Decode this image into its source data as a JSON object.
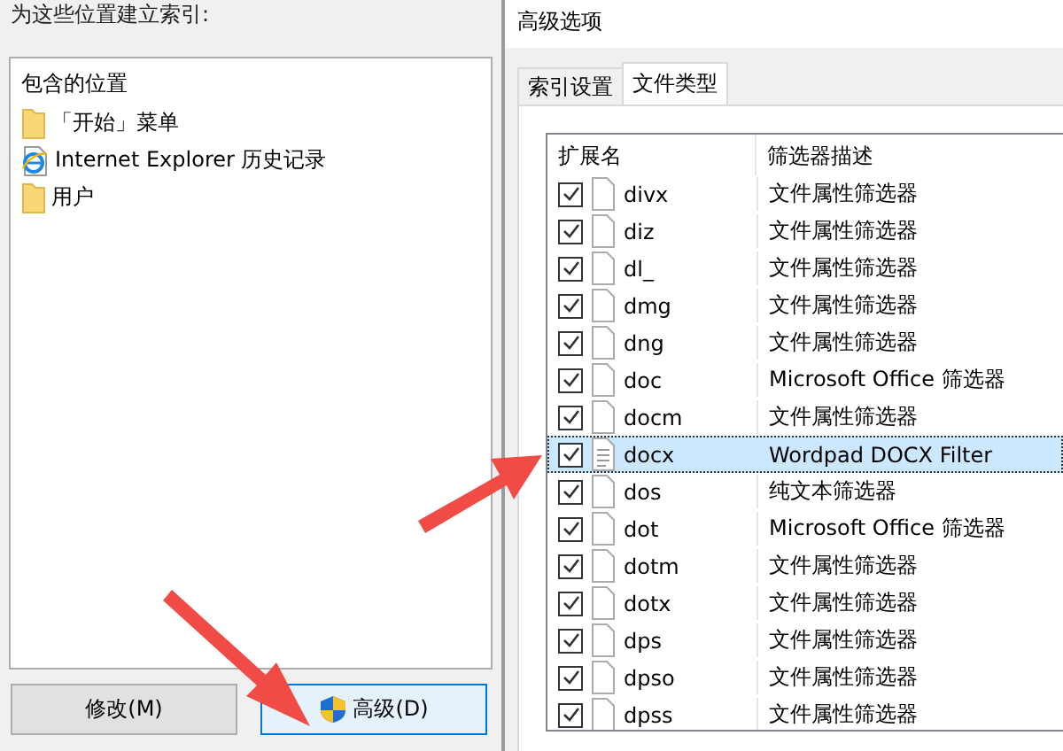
{
  "left_panel": {
    "heading": "为这些位置建立索引:",
    "locations": {
      "header": "包含的位置",
      "items": [
        {
          "kind": "folder",
          "label": "「开始」菜单"
        },
        {
          "kind": "ie",
          "label": "Internet Explorer 历史记录"
        },
        {
          "kind": "folder",
          "label": "用户"
        }
      ]
    },
    "buttons": [
      {
        "label": "修改(M)",
        "shield": false,
        "selected": false
      },
      {
        "label": "高级(D)",
        "shield": true,
        "selected": true
      }
    ]
  },
  "dialog": {
    "title": "高级选项",
    "tabs": [
      {
        "label": "索引设置",
        "selected": false
      },
      {
        "label": "文件类型",
        "selected": true
      }
    ],
    "table": {
      "columns": [
        "扩展名",
        "筛选器描述"
      ],
      "rows": [
        {
          "checked": true,
          "kind": "blank",
          "ext": "divx",
          "filter": "文件属性筛选器",
          "selected": false
        },
        {
          "checked": true,
          "kind": "blank",
          "ext": "diz",
          "filter": "文件属性筛选器",
          "selected": false
        },
        {
          "checked": true,
          "kind": "blank",
          "ext": "dl_",
          "filter": "文件属性筛选器",
          "selected": false
        },
        {
          "checked": true,
          "kind": "blank",
          "ext": "dmg",
          "filter": "文件属性筛选器",
          "selected": false
        },
        {
          "checked": true,
          "kind": "blank",
          "ext": "dng",
          "filter": "文件属性筛选器",
          "selected": false
        },
        {
          "checked": true,
          "kind": "blank",
          "ext": "doc",
          "filter": "Microsoft Office 筛选器",
          "selected": false
        },
        {
          "checked": true,
          "kind": "blank",
          "ext": "docm",
          "filter": "文件属性筛选器",
          "selected": false
        },
        {
          "checked": true,
          "kind": "text",
          "ext": "docx",
          "filter": "Wordpad DOCX Filter",
          "selected": true
        },
        {
          "checked": true,
          "kind": "blank",
          "ext": "dos",
          "filter": "纯文本筛选器",
          "selected": false
        },
        {
          "checked": true,
          "kind": "blank",
          "ext": "dot",
          "filter": "Microsoft Office 筛选器",
          "selected": false
        },
        {
          "checked": true,
          "kind": "blank",
          "ext": "dotm",
          "filter": "文件属性筛选器",
          "selected": false
        },
        {
          "checked": true,
          "kind": "blank",
          "ext": "dotx",
          "filter": "文件属性筛选器",
          "selected": false
        },
        {
          "checked": true,
          "kind": "blank",
          "ext": "dps",
          "filter": "文件属性筛选器",
          "selected": false
        },
        {
          "checked": true,
          "kind": "blank",
          "ext": "dpso",
          "filter": "文件属性筛选器",
          "selected": false
        },
        {
          "checked": true,
          "kind": "blank",
          "ext": "dpss",
          "filter": "文件属性筛选器",
          "selected": false
        }
      ]
    }
  }
}
